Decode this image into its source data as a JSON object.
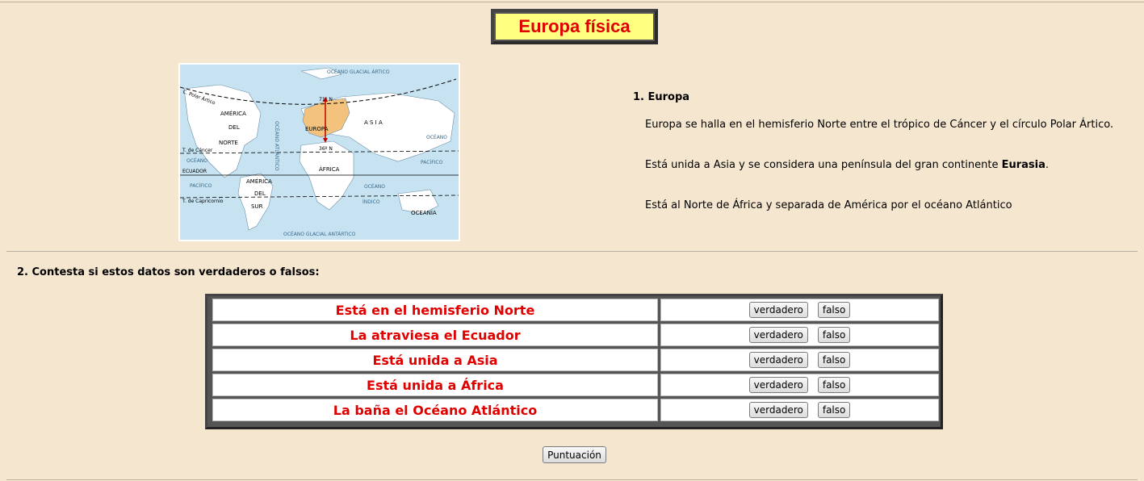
{
  "page": {
    "title": "Europa física"
  },
  "map": {
    "labels": {
      "polar": "C. Polar Ártico",
      "oceano_glacial_artico": "OCÉANO GLACIAL ÁRTICO",
      "america_del_norte_1": "AMÉRICA",
      "america_del_norte_2": "DEL",
      "america_del_norte_3": "NORTE",
      "europa": "EUROPA",
      "asia": "A S I A",
      "lat_71": "71º N",
      "lat_36": "36º N",
      "oceano_atlantico": "OCÉANO ATLÁNTICO",
      "tropico_cancer": "T. de Cáncer",
      "oceano_left": "OCÉANO",
      "pacifico_left": "PACÍFICO",
      "ecuador": "ECUADOR",
      "africa": "ÁFRICA",
      "oceano_right": "OCÉANO",
      "pacifico_right": "PACÍFICO",
      "oceano_indico_1": "OCÉANO",
      "oceano_indico_2": "ÍNDICO",
      "america_del_sur_1": "AMÉRICA",
      "america_del_sur_2": "DEL",
      "america_del_sur_3": "SUR",
      "tropico_capricornio": "T. de Capricornio",
      "oceania": "OCEANÍA",
      "oceano_glacial_antartico": "OCÉANO GLACIAL ANTÁRTICO"
    }
  },
  "section1": {
    "heading": "1. Europa",
    "p1": "Europa se halla en el hemisferio Norte entre el trópico de Cáncer y el círculo Polar Ártico.",
    "p2_pre": "Está unida a Asia y se considera  una península del gran continente ",
    "p2_bold": "Eurasia",
    "p2_post": ".",
    "p3": "Está al Norte de África y separada de América por el océano Atlántico"
  },
  "section2": {
    "heading": "2. Contesta si estos datos son verdaderos o falsos:",
    "questions": [
      {
        "text": "Está en el hemisferio Norte",
        "true_label": "verdadero",
        "false_label": "falso"
      },
      {
        "text": "La atraviesa el Ecuador",
        "true_label": "verdadero",
        "false_label": "falso"
      },
      {
        "text": "Está unida a Asia",
        "true_label": "verdadero",
        "false_label": "falso"
      },
      {
        "text": "Está unida a África",
        "true_label": "verdadero",
        "false_label": "falso"
      },
      {
        "text": "La baña el Océano Atlántico",
        "true_label": "verdadero",
        "false_label": "falso"
      }
    ],
    "score_button": "Puntuación"
  },
  "colors": {
    "background": "#f5e6d0",
    "title_bg": "#ffff80",
    "accent_red": "#e00000"
  }
}
